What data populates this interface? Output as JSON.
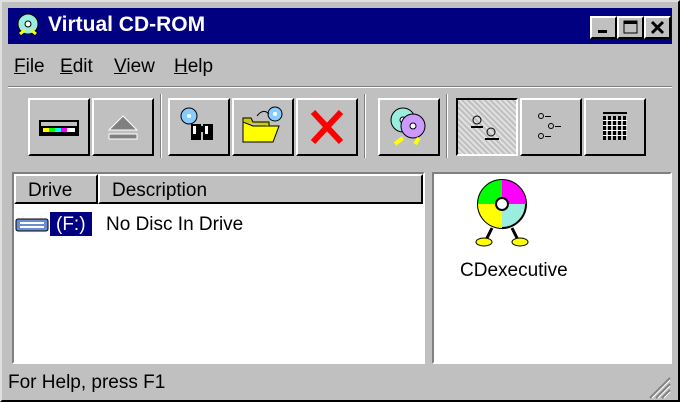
{
  "window": {
    "title": "Virtual CD-ROM"
  },
  "title_buttons": {
    "minimize": "minimize",
    "maximize": "maximize",
    "close": "close"
  },
  "menu": {
    "items": [
      {
        "label": "File",
        "access": "F",
        "rest": "ile"
      },
      {
        "label": "Edit",
        "access": "E",
        "rest": "dit"
      },
      {
        "label": "View",
        "access": "V",
        "rest": "iew"
      },
      {
        "label": "Help",
        "access": "H",
        "rest": "elp"
      }
    ]
  },
  "toolbar": {
    "icons": [
      "drive-icon",
      "eject-icon",
      "find-icon",
      "open-folder-icon",
      "delete-icon",
      "cd-executive-icon",
      "large-icons-view-icon",
      "small-icons-view-icon",
      "details-view-icon"
    ]
  },
  "drives_list": {
    "columns": [
      "Drive",
      "Description"
    ],
    "rows": [
      {
        "drive": "(F:)",
        "description": "No Disc In Drive"
      }
    ]
  },
  "right_panel": {
    "item_label": "CDexecutive"
  },
  "statusbar": {
    "text": "For Help, press F1"
  }
}
